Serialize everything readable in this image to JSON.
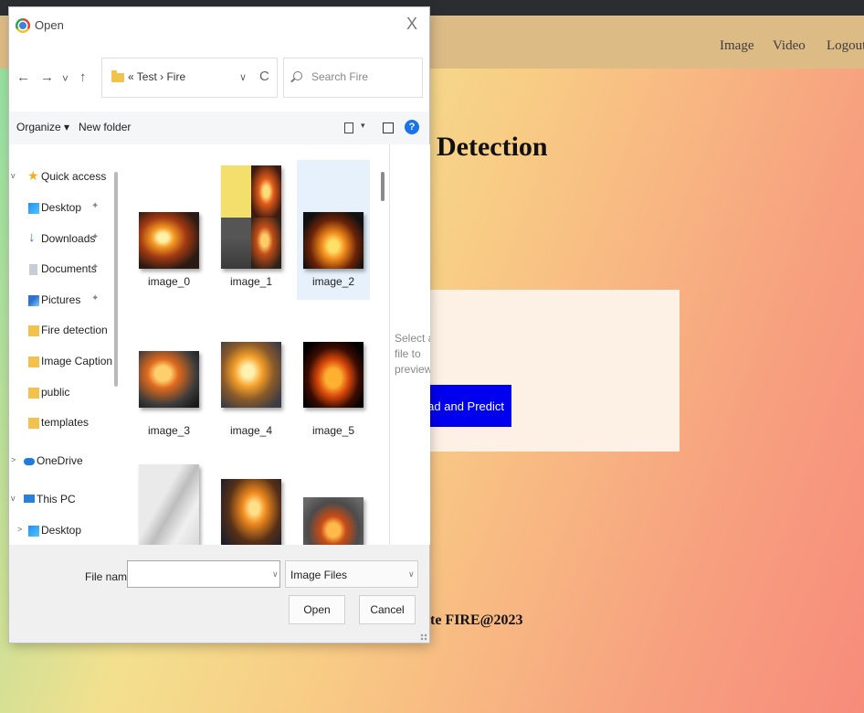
{
  "webpage": {
    "nav": [
      "Image",
      "Video",
      "Logout"
    ],
    "heading": "Detection",
    "upload_button": "load and Predict",
    "footer": "te FIRE@2023"
  },
  "dialog": {
    "title": "Open",
    "close_glyph": "X",
    "nav_glyphs": {
      "back": "←",
      "forward": "→",
      "recent": "˅",
      "up": "↑"
    },
    "address": {
      "path": "« Test › Fire",
      "dropdown": "∨",
      "refresh": "C"
    },
    "search_placeholder": "Search Fire",
    "toolbar": {
      "organize": "Organize ▾",
      "new_folder": "New folder",
      "view_dropdown": "▾",
      "help": "?"
    },
    "nav_pane": [
      {
        "label": "Quick access",
        "icon": "star-icon",
        "chevron": "v",
        "pinned": false
      },
      {
        "label": "Desktop",
        "icon": "desktop-icon",
        "chevron": "",
        "pinned": true
      },
      {
        "label": "Downloads",
        "icon": "download-icon",
        "chevron": "",
        "pinned": true
      },
      {
        "label": "Documents",
        "icon": "document-icon",
        "chevron": "",
        "pinned": true
      },
      {
        "label": "Pictures",
        "icon": "pictures-icon",
        "chevron": "",
        "pinned": true
      },
      {
        "label": "Fire detection",
        "icon": "folder-icon",
        "chevron": "",
        "pinned": false
      },
      {
        "label": "Image Captionir",
        "icon": "folder-icon",
        "chevron": "",
        "pinned": false
      },
      {
        "label": "public",
        "icon": "folder-icon",
        "chevron": "",
        "pinned": false
      },
      {
        "label": "templates",
        "icon": "folder-icon",
        "chevron": "",
        "pinned": false
      },
      {
        "label": "OneDrive",
        "icon": "cloud-icon",
        "chevron": ">",
        "pinned": false
      },
      {
        "label": "This PC",
        "icon": "computer-icon",
        "chevron": "v",
        "pinned": false
      },
      {
        "label": "Desktop",
        "icon": "desktop-icon",
        "chevron": ">",
        "pinned": false
      }
    ],
    "files": [
      {
        "name": "image_0",
        "selected": false
      },
      {
        "name": "image_1",
        "selected": false
      },
      {
        "name": "image_2",
        "selected": true
      },
      {
        "name": "image_3",
        "selected": false
      },
      {
        "name": "image_4",
        "selected": false
      },
      {
        "name": "image_5",
        "selected": false
      },
      {
        "name": "",
        "selected": false
      },
      {
        "name": "",
        "selected": false
      },
      {
        "name": "",
        "selected": false
      }
    ],
    "preview_text": "Select a file to preview.",
    "file_name_label": "File name:",
    "file_name_value": "",
    "file_type": "Image Files",
    "dropdown_glyph": "∨",
    "open_button": "Open",
    "cancel_button": "Cancel"
  }
}
